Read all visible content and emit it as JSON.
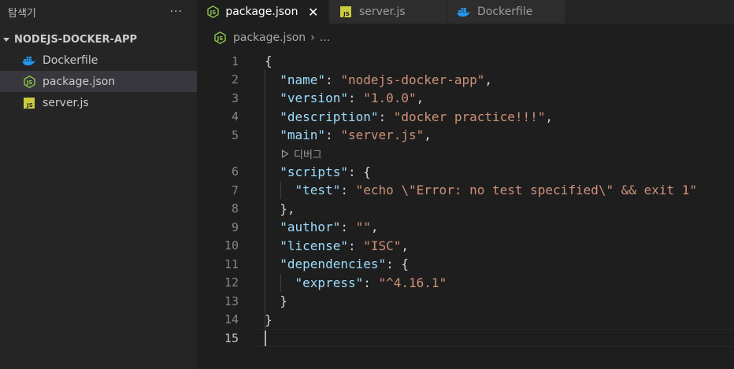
{
  "explorer": {
    "title": "탐색기",
    "more": "···",
    "folder": "NODEJS-DOCKER-APP",
    "files": [
      {
        "name": "Dockerfile",
        "icon": "docker-icon"
      },
      {
        "name": "package.json",
        "icon": "nodejs-icon"
      },
      {
        "name": "server.js",
        "icon": "js-icon"
      }
    ]
  },
  "tabs": [
    {
      "label": "package.json",
      "icon": "nodejs-icon",
      "active": true,
      "close": "✕"
    },
    {
      "label": "server.js",
      "icon": "js-icon",
      "active": false
    },
    {
      "label": "Dockerfile",
      "icon": "docker-icon",
      "active": false
    }
  ],
  "breadcrumb": {
    "file": "package.json",
    "sep": "›",
    "more": "..."
  },
  "codelens": {
    "label": "디버그"
  },
  "editor": {
    "line_numbers": [
      "1",
      "2",
      "3",
      "4",
      "5",
      "6",
      "7",
      "8",
      "9",
      "10",
      "11",
      "12",
      "13",
      "14",
      "15"
    ],
    "code": {
      "l1": "{",
      "name_key": "\"name\"",
      "name_val": "\"nodejs-docker-app\"",
      "version_key": "\"version\"",
      "version_val": "\"1.0.0\"",
      "description_key": "\"description\"",
      "description_val": "\"docker practice!!!\"",
      "main_key": "\"main\"",
      "main_val": "\"server.js\"",
      "scripts_key": "\"scripts\"",
      "test_key": "\"test\"",
      "test_val": "\"echo \\\"Error: no test specified\\\" && exit 1\"",
      "scripts_close": "},",
      "author_key": "\"author\"",
      "author_val": "\"\"",
      "license_key": "\"license\"",
      "license_val": "\"ISC\"",
      "deps_key": "\"dependencies\"",
      "express_key": "\"express\"",
      "express_val": "\"^4.16.1\"",
      "deps_close": "}",
      "end": "}"
    }
  },
  "colors": {
    "json_key": "#9cdcfe",
    "json_string": "#ce9178",
    "node_green": "#8cc84b",
    "js_yellow": "#cbcb41",
    "docker_blue": "#2496ed"
  }
}
